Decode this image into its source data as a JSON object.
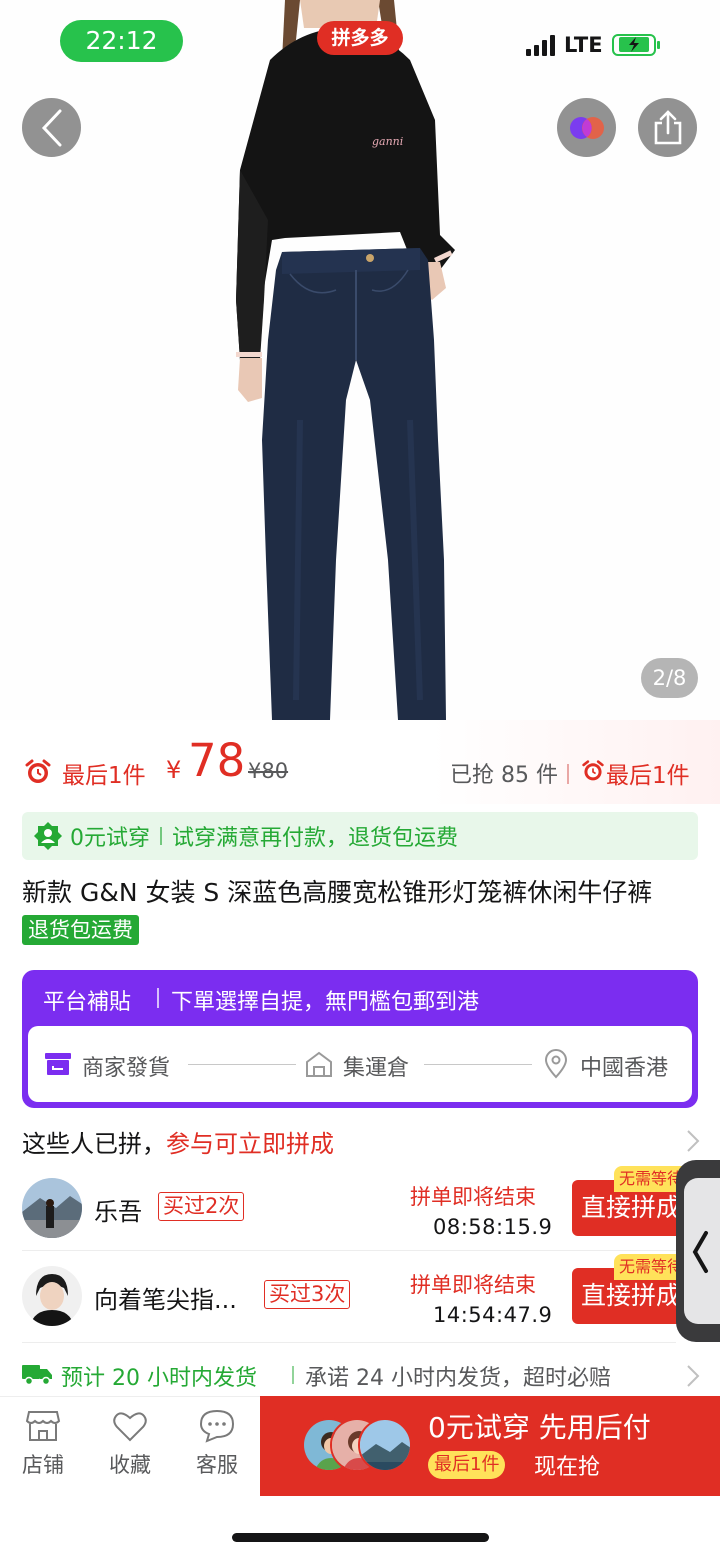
{
  "status_bar": {
    "time": "22:12",
    "brand": "拼多多",
    "network": "LTE"
  },
  "gallery": {
    "counter": "2/8"
  },
  "price": {
    "last_one_label": "最后1件",
    "currency": "¥",
    "current": "78",
    "original": "¥80",
    "grabbed": "已抢 85 件",
    "last_one_label_2": "最后1件"
  },
  "try_banner": {
    "left": "0元试穿",
    "right": "试穿满意再付款，退货包运费"
  },
  "title": {
    "text": "新款 G&N 女装 S 深蓝色高腰宽松锥形灯笼裤休闲牛仔裤",
    "tag": "退货包运费"
  },
  "platform": {
    "head": "平台補貼",
    "desc": "下單選擇自提，無門檻包郵到港",
    "steps": [
      "商家發貨",
      "集運倉",
      "中國香港"
    ]
  },
  "group": {
    "head": "这些人已拼，",
    "head_red": "参与可立即拼成",
    "people": [
      {
        "name": "乐吾",
        "bought": "买过2次",
        "ending": "拼单即将结束",
        "countdown": "08:58:15.9",
        "button": "直接拼成",
        "badge": "无需等待"
      },
      {
        "name": "向着笔尖指...",
        "bought": "买过3次",
        "ending": "拼单即将结束",
        "countdown": "14:54:47.9",
        "button": "直接拼成",
        "badge": "无需等待"
      }
    ]
  },
  "delivery": {
    "green": "预计 20 小时内发货",
    "text": "承诺 24 小时内发货，超时必赔"
  },
  "bottom_bar": {
    "tabs": [
      "店铺",
      "收藏",
      "客服"
    ],
    "buy_main": "0元试穿 先用后付",
    "buy_pill": "最后1件",
    "buy_now": "现在抢"
  },
  "colors": {
    "accent_red": "#e02e24",
    "green": "#25a935",
    "purple": "#7b2df0",
    "yellow": "#ffe25a"
  }
}
